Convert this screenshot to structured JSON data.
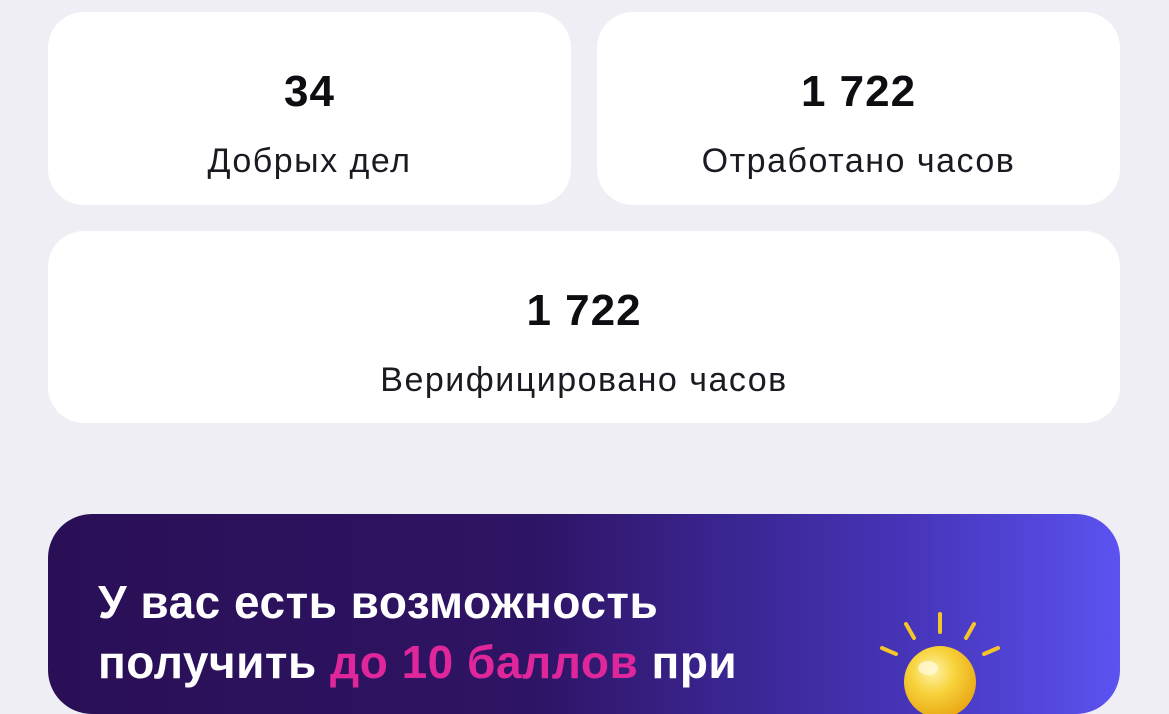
{
  "stats": {
    "deeds": {
      "value": "34",
      "label": "Добрых дел"
    },
    "worked": {
      "value": "1 722",
      "label": "Отработано часов"
    },
    "verified": {
      "value": "1 722",
      "label": "Верифицировано часов"
    }
  },
  "promo": {
    "line1": "У вас есть возможность",
    "line2_start": "получить ",
    "highlight": "до 10 баллов",
    "line2_end": " при",
    "icon": "lightbulb-icon",
    "colors": {
      "gradient_start": "#2a0f56",
      "gradient_end": "#5b52f0",
      "highlight": "#e0269b",
      "bulb": "#f5c518"
    }
  }
}
